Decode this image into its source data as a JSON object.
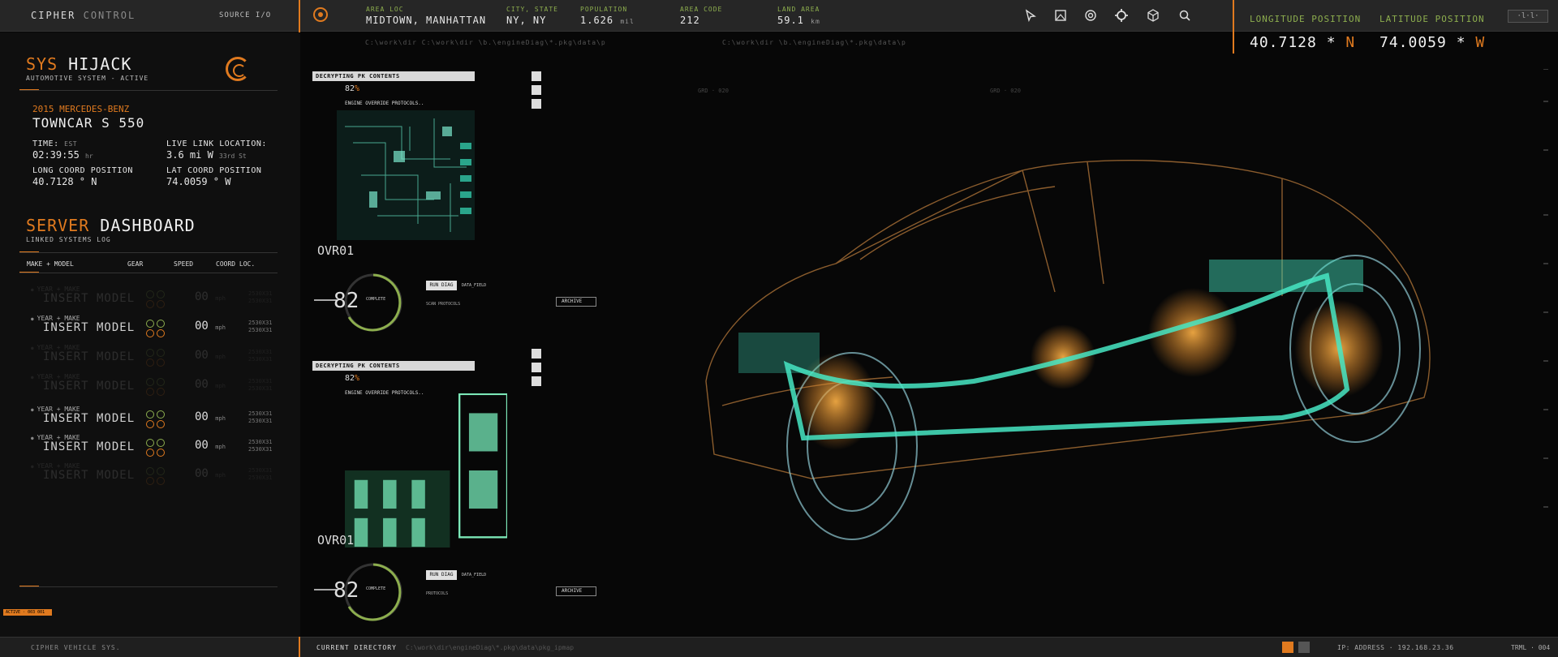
{
  "topbar": {
    "brand_main": "CIPHER",
    "brand_dim": "CONTROL",
    "source_label": "SOURCE I/O",
    "fields": [
      {
        "label": "AREA LOC",
        "value": "MIDTOWN, MANHATTAN",
        "unit": ""
      },
      {
        "label": "CITY, STATE",
        "value": "NY, NY",
        "unit": ""
      },
      {
        "label": "POPULATION",
        "value": "1.626",
        "unit": "mil"
      },
      {
        "label": "AREA CODE",
        "value": "212",
        "unit": ""
      },
      {
        "label": "LAND AREA",
        "value": "59.1",
        "unit": "km"
      }
    ],
    "tools": [
      "cursor-icon",
      "image-icon",
      "target-icon",
      "crosshair-icon",
      "cube-icon",
      "search-icon"
    ],
    "longitude_label": "LONGITUDE POSITION",
    "longitude_value": "40.7128 *",
    "longitude_dir": "N",
    "latitude_label": "LATITUDE POSITION",
    "latitude_value": "74.0059 *",
    "latitude_dir": "W",
    "corner_button": "·l·l·"
  },
  "sidebar": {
    "sys_title_accent": "SYS",
    "sys_title_rest": "HIJACK",
    "sys_subtitle": "AUTOMOTIVE SYSTEM - ACTIVE",
    "car_year": "2015 MERCEDES-BENZ",
    "car_model": "TOWNCAR S 550",
    "time_label": "TIME:",
    "time_unit_label": "EST",
    "time_value": "02:39:55",
    "time_suffix": "hr",
    "live_label": "LIVE LINK LOCATION:",
    "live_value": "3.6 mi W",
    "live_suffix": "33rd St",
    "long_label": "LONG COORD POSITION",
    "long_value": "40.7128 °  N",
    "lat_label": "LAT COORD POSITION",
    "lat_value": "74.0059 °  W",
    "dash_title_accent": "SERVER",
    "dash_title_rest": "DASHBOARD",
    "dash_subtitle": "LINKED SYSTEMS LOG",
    "columns": [
      "MAKE + MODEL",
      "GEAR",
      "SPEED",
      "COORD LOC."
    ],
    "rows": [
      {
        "year_make": "YEAR + MAKE",
        "model": "INSERT MODEL",
        "speed": "00",
        "unit": "mph",
        "coord": "2530X31\n2530X31",
        "faded": true
      },
      {
        "year_make": "YEAR + MAKE",
        "model": "INSERT MODEL",
        "speed": "00",
        "unit": "mph",
        "coord": "2530X31\n2530X31",
        "faded": false
      },
      {
        "year_make": "YEAR + MAKE",
        "model": "INSERT MODEL",
        "speed": "00",
        "unit": "mph",
        "coord": "2530X31\n2530X31",
        "faded": true
      },
      {
        "year_make": "YEAR + MAKE",
        "model": "INSERT MODEL",
        "speed": "00",
        "unit": "mph",
        "coord": "2530X31\n2530X31",
        "faded": true
      },
      {
        "year_make": "YEAR + MAKE",
        "model": "INSERT MODEL",
        "speed": "00",
        "unit": "mph",
        "coord": "2530X31\n2530X31",
        "faded": false
      },
      {
        "year_make": "YEAR + MAKE",
        "model": "INSERT MODEL",
        "speed": "00",
        "unit": "mph",
        "coord": "2530X31\n2530X31",
        "faded": false
      },
      {
        "year_make": "YEAR + MAKE",
        "model": "INSERT MODEL",
        "speed": "00",
        "unit": "mph",
        "coord": "2530X31\n2530X31",
        "faded": true
      }
    ],
    "bottom_tag": "ACTIVE · 003 001"
  },
  "panels": [
    {
      "header": "DECRYPTING PK CONTENTS",
      "pct": "82",
      "eop": "ENGINE OVERRIDE PROTOCOLS..",
      "ovr": "OVR01",
      "big": "82",
      "complete": "COMPLETE",
      "run": "RUN DIAG",
      "datafield": "DATA_FIELD",
      "scan": "SCAN PROTOCOLS",
      "archive": "ARCHIVE"
    },
    {
      "header": "DECRYPTING PK CONTENTS",
      "pct": "82",
      "eop": "ENGINE OVERRIDE PROTOCOLS..",
      "ovr": "OVR01",
      "big": "82",
      "complete": "COMPLETE",
      "run": "RUN DIAG",
      "datafield": "DATA_FIELD",
      "scan": "PROTOCOLS",
      "archive": "ARCHIVE"
    }
  ],
  "bottombar": {
    "left": "CIPHER VEHICLE SYS.",
    "dir_label": "CURRENT DIRECTORY",
    "ip": "IP: ADDRESS · 192.168.23.36",
    "right": "TRML · 004"
  },
  "colors": {
    "accent": "#e07a1f",
    "green": "#8dae4e",
    "cyan": "#46e6c3"
  }
}
